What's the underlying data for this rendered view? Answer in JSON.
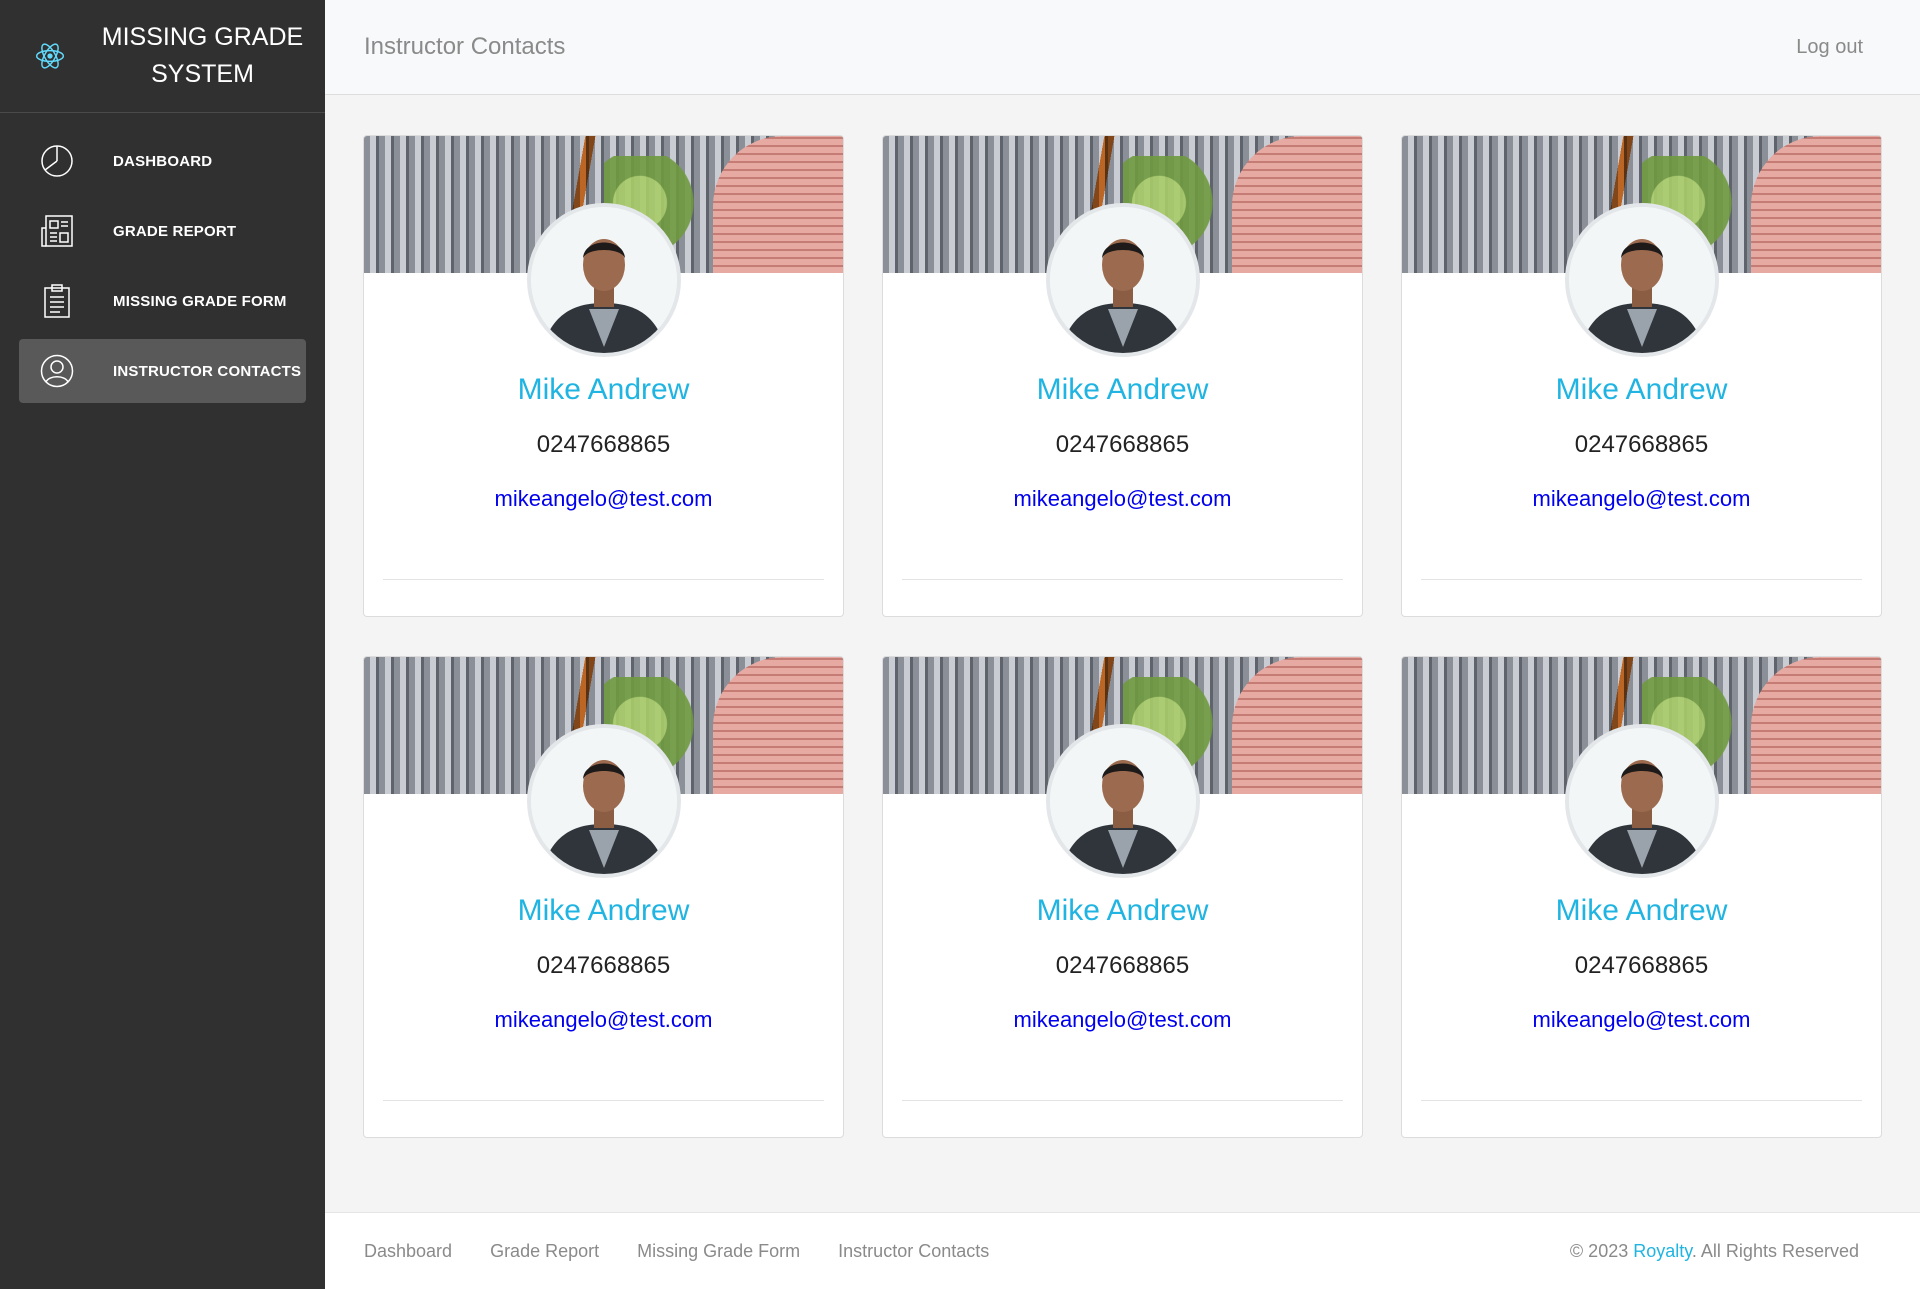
{
  "app": {
    "brand_line1": "MISSING GRADE",
    "brand_line2": "SYSTEM",
    "logo_icon": "react-atom-icon",
    "accent_color": "#1fb4e1"
  },
  "sidebar": {
    "items": [
      {
        "label": "DASHBOARD",
        "icon": "pie-chart-icon",
        "active": false
      },
      {
        "label": "GRADE REPORT",
        "icon": "newspaper-icon",
        "active": false
      },
      {
        "label": "MISSING GRADE FORM",
        "icon": "clipboard-icon",
        "active": false
      },
      {
        "label": "INSTRUCTOR CONTACTS",
        "icon": "user-circle-icon",
        "active": true
      }
    ]
  },
  "header": {
    "title": "Instructor Contacts",
    "logout_label": "Log out"
  },
  "contacts": [
    {
      "name": "Mike Andrew",
      "phone": "0247668865",
      "email": "mikeangelo@test.com"
    },
    {
      "name": "Mike Andrew",
      "phone": "0247668865",
      "email": "mikeangelo@test.com"
    },
    {
      "name": "Mike Andrew",
      "phone": "0247668865",
      "email": "mikeangelo@test.com"
    },
    {
      "name": "Mike Andrew",
      "phone": "0247668865",
      "email": "mikeangelo@test.com"
    },
    {
      "name": "Mike Andrew",
      "phone": "0247668865",
      "email": "mikeangelo@test.com"
    },
    {
      "name": "Mike Andrew",
      "phone": "0247668865",
      "email": "mikeangelo@test.com"
    }
  ],
  "footer": {
    "links": [
      "Dashboard",
      "Grade Report",
      "Missing Grade Form",
      "Instructor Contacts"
    ],
    "copyright_prefix": "© 2023 ",
    "copyright_brand": "Royalty",
    "copyright_suffix": ". All Rights Reserved"
  }
}
